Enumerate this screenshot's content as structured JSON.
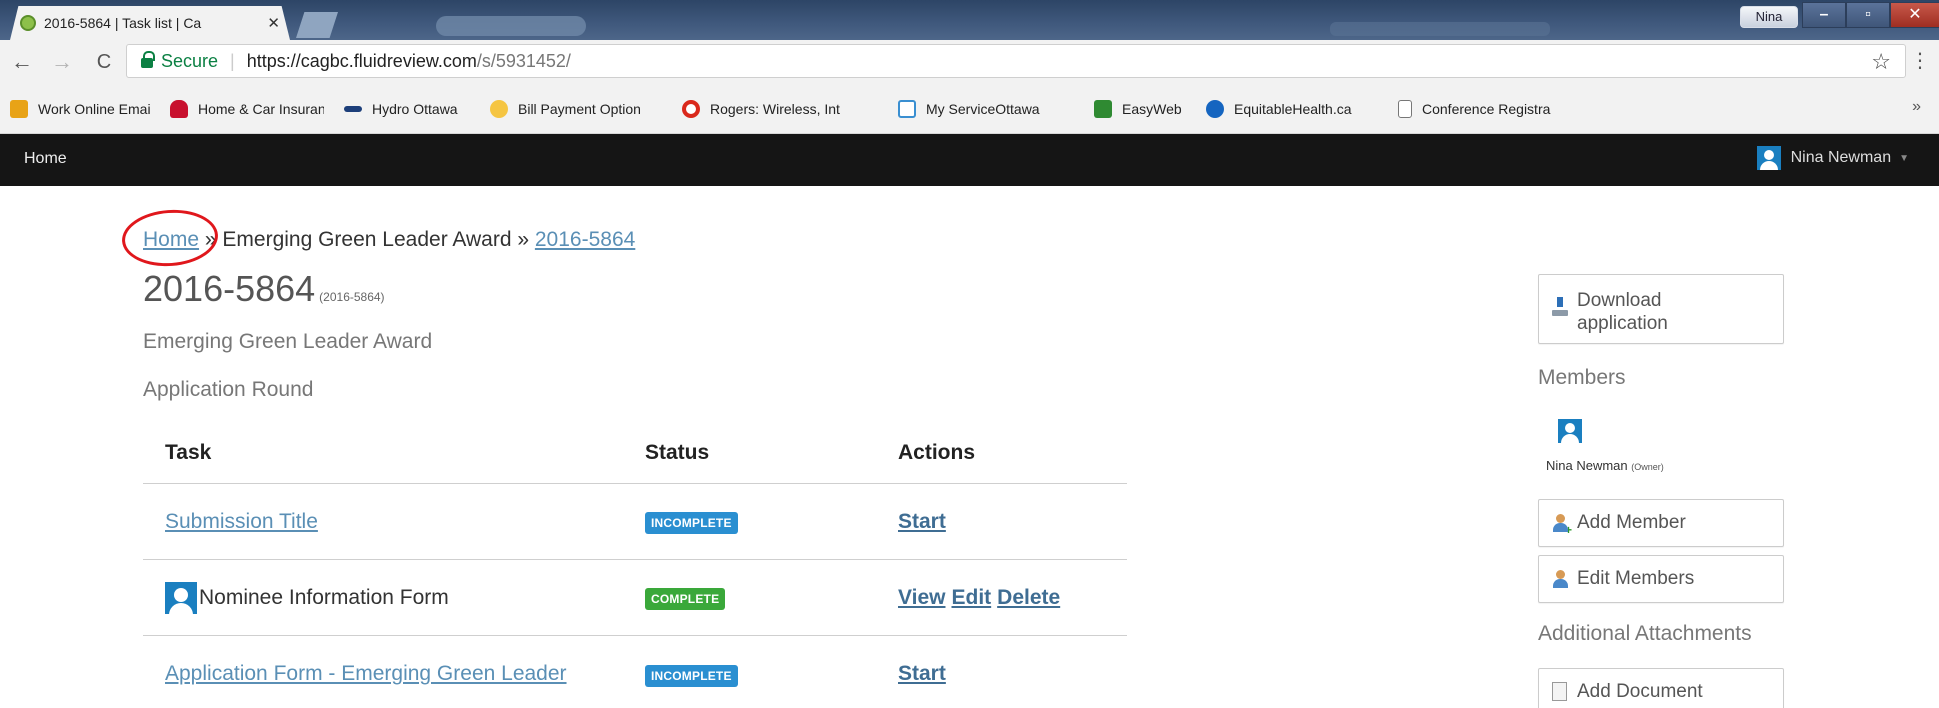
{
  "browser": {
    "tab_title": "2016-5864 | Task list | Ca",
    "tab_close": "✕",
    "profile_name": "Nina",
    "window_controls": {
      "minimize": "–",
      "maximize": "▫",
      "close": "✕"
    },
    "back": "←",
    "forward": "→",
    "reload": "C",
    "secure_label": "Secure",
    "url_host": "https://cagbc.fluidreview.com",
    "url_path": "/s/5931452/",
    "star": "☆",
    "menu": "⋮",
    "bookmarks": [
      {
        "label": "Work Online Email",
        "icon": "outlook-icon",
        "color": "#e8a317"
      },
      {
        "label": "Home & Car Insuran",
        "icon": "car-icon",
        "color": "#c8102e"
      },
      {
        "label": "Hydro Ottawa",
        "icon": "hydro-icon",
        "color": "#1d3f7a"
      },
      {
        "label": "Bill Payment Option",
        "icon": "bill-icon",
        "color": "#f5c542"
      },
      {
        "label": "Rogers: Wireless, Int",
        "icon": "rogers-icon",
        "color": "#da291c"
      },
      {
        "label": "My ServiceOttawa",
        "icon": "serviceottawa-icon",
        "color": "#3a8fd1"
      },
      {
        "label": "EasyWeb",
        "icon": "td-icon",
        "color": "#2f8a32"
      },
      {
        "label": "EquitableHealth.ca",
        "icon": "equitable-icon",
        "color": "#1565c0"
      },
      {
        "label": "Conference Registra",
        "icon": "page-icon",
        "color": "#ffffff"
      }
    ],
    "bookmarks_more": "»"
  },
  "site": {
    "nav_home": "Home",
    "user_name": "Nina Newman",
    "user_caret": "▼"
  },
  "breadcrumb": {
    "home": "Home",
    "sep1": " » ",
    "award": "Emerging Green Leader Award",
    "sep2": " » ",
    "current": "2016-5864"
  },
  "page": {
    "title": "2016-5864",
    "title_small": "(2016-5864)",
    "award": "Emerging Green Leader Award",
    "round": "Application Round"
  },
  "table": {
    "headers": {
      "task": "Task",
      "status": "Status",
      "actions": "Actions"
    },
    "rows": [
      {
        "task": "Submission Title",
        "status": "INCOMPLETE",
        "actions": [
          "Start"
        ]
      },
      {
        "task": "Nominee Information Form",
        "status": "COMPLETE",
        "actions": [
          "View",
          "Edit",
          "Delete"
        ]
      },
      {
        "task": "Application Form - Emerging Green Leader",
        "status": "INCOMPLETE",
        "actions": [
          "Start"
        ]
      }
    ]
  },
  "sidebar": {
    "download_line1": "Download",
    "download_line2": "application",
    "members_heading": "Members",
    "member_name": "Nina Newman",
    "member_role": "(Owner)",
    "add_member": "Add Member",
    "edit_members": "Edit Members",
    "attachments_heading": "Additional Attachments",
    "add_document": "Add Document"
  }
}
